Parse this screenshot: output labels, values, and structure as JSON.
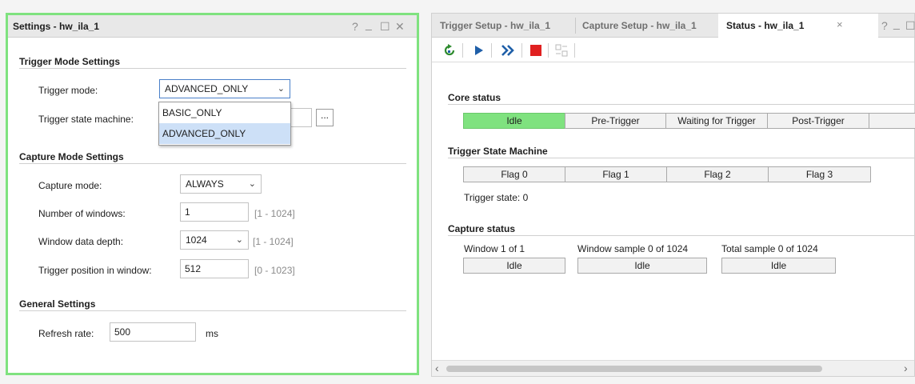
{
  "settings_panel": {
    "title": "Settings - hw_ila_1",
    "window_controls": [
      "?",
      "_",
      "☐",
      "✕"
    ],
    "trigger_mode_section": {
      "heading": "Trigger Mode Settings",
      "trigger_mode_label": "Trigger mode:",
      "trigger_mode_value": "ADVANCED_ONLY",
      "trigger_mode_options": [
        "BASIC_ONLY",
        "ADVANCED_ONLY"
      ],
      "state_machine_label": "Trigger state machine:",
      "browse_label": "..."
    },
    "capture_mode_section": {
      "heading": "Capture Mode Settings",
      "capture_mode_label": "Capture mode:",
      "capture_mode_value": "ALWAYS",
      "windows_label": "Number of windows:",
      "windows_value": "1",
      "windows_range": "[1 - 1024]",
      "depth_label": "Window data depth:",
      "depth_value": "1024",
      "depth_range": "[1 - 1024]",
      "position_label": "Trigger position in window:",
      "position_value": "512",
      "position_range": "[0 - 1023]"
    },
    "general_section": {
      "heading": "General Settings",
      "refresh_label": "Refresh rate:",
      "refresh_value": "500",
      "refresh_unit": "ms"
    }
  },
  "status_panel": {
    "tabs": [
      {
        "label": "Trigger Setup - hw_ila_1",
        "active": false
      },
      {
        "label": "Capture Setup - hw_ila_1",
        "active": false
      },
      {
        "label": "Status - hw_ila_1",
        "active": true
      }
    ],
    "tab_close": "×",
    "window_controls": [
      "?",
      "_",
      "☐"
    ],
    "toolbar_icons": [
      "refresh-arrow-icon",
      "run-trigger-icon",
      "run-immediate-icon",
      "stop-icon",
      "disabled-export-icon"
    ],
    "core_status": {
      "heading": "Core status",
      "states": [
        "Idle",
        "Pre-Trigger",
        "Waiting for Trigger",
        "Post-Trigger"
      ],
      "active_state": "Idle"
    },
    "state_machine": {
      "heading": "Trigger State Machine",
      "flags": [
        "Flag 0",
        "Flag 1",
        "Flag 2",
        "Flag 3"
      ],
      "trigger_state": "Trigger state: 0"
    },
    "capture_status": {
      "heading": "Capture status",
      "window_label": "Window 1 of 1",
      "window_value": "Idle",
      "window_sample_label": "Window sample 0 of 1024",
      "window_sample_value": "Idle",
      "total_sample_label": "Total sample 0 of 1024",
      "total_sample_value": "Idle"
    },
    "scroll_left": "‹",
    "scroll_right": "›"
  },
  "colors": {
    "active_green": "#7fe27f",
    "stop_red": "#e02020",
    "play_blue": "#1f5fa8",
    "refresh_green": "#2e8b2e"
  }
}
